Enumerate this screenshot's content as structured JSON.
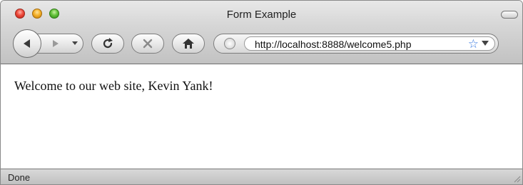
{
  "window": {
    "title": "Form Example"
  },
  "toolbar": {
    "back_icon": "back-arrow-icon",
    "forward_icon": "forward-arrow-icon",
    "history_dropdown_icon": "chevron-down-icon",
    "reload_icon": "reload-icon",
    "stop_icon": "close-icon",
    "home_icon": "home-icon"
  },
  "address_bar": {
    "url": "http://localhost:8888/welcome5.php",
    "site_icon": "globe-icon",
    "bookmark_icon": "star-icon",
    "dropdown_icon": "chevron-down-icon",
    "star_color": "#3b7be0"
  },
  "page": {
    "message": "Welcome to our web site, Kevin Yank!"
  },
  "status_bar": {
    "text": "Done"
  }
}
